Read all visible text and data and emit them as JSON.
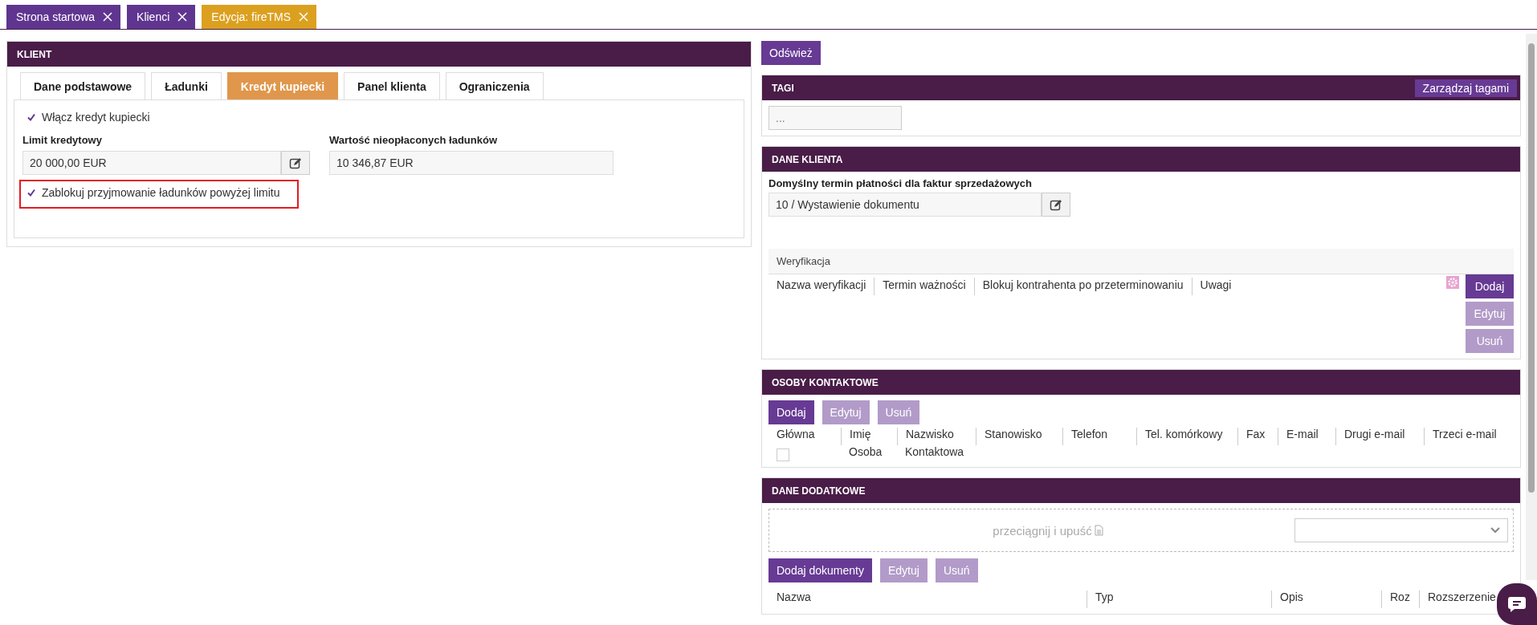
{
  "tabs": [
    {
      "label": "Strona startowa",
      "selected": false
    },
    {
      "label": "Klienci",
      "selected": false
    },
    {
      "label": "Edycja: fireTMS",
      "selected": true
    }
  ],
  "client": {
    "title": "KLIENT",
    "tabs": [
      {
        "label": "Dane podstawowe",
        "selected": false
      },
      {
        "label": "Ładunki",
        "selected": false
      },
      {
        "label": "Kredyt kupiecki",
        "selected": true
      },
      {
        "label": "Panel klienta",
        "selected": false
      },
      {
        "label": "Ograniczenia",
        "selected": false
      }
    ],
    "enable_credit": {
      "label": "Włącz kredyt kupiecki",
      "checked": true
    },
    "credit_limit": {
      "label": "Limit kredytowy",
      "value": "20 000,00 EUR"
    },
    "unpaid_value": {
      "label": "Wartość nieopłaconych ładunków",
      "value": "10 346,87 EUR"
    },
    "block_over_limit": {
      "label": "Zablokuj przyjmowanie ładunków powyżej limitu",
      "checked": true,
      "highlighted": true
    }
  },
  "refresh_button": "Odśwież",
  "tags": {
    "title": "TAGI",
    "manage_button": "Zarządzaj tagami",
    "placeholder": "..."
  },
  "client_data": {
    "title": "DANE KLIENTA",
    "payment_term": {
      "label": "Domyślny termin płatności dla faktur sprzedażowych",
      "value": "10 / Wystawienie dokumentu"
    },
    "verification": {
      "title": "Weryfikacja",
      "columns": [
        "Nazwa weryfikacji",
        "Termin ważności",
        "Blokuj kontrahenta po przeterminowaniu",
        "Uwagi"
      ],
      "buttons": [
        {
          "label": "Dodaj",
          "disabled": false
        },
        {
          "label": "Edytuj",
          "disabled": true
        },
        {
          "label": "Usuń",
          "disabled": true
        }
      ]
    }
  },
  "contacts": {
    "title": "OSOBY KONTAKTOWE",
    "buttons": [
      {
        "label": "Dodaj",
        "disabled": false
      },
      {
        "label": "Edytuj",
        "disabled": true
      },
      {
        "label": "Usuń",
        "disabled": true
      }
    ],
    "columns": [
      "Główna",
      "Imię",
      "Nazwisko",
      "Stanowisko",
      "Telefon",
      "Tel. komórkowy",
      "Fax",
      "E-mail",
      "Drugi e-mail",
      "Trzeci e-mail"
    ],
    "rows": [
      {
        "main": false,
        "first_name": "Osoba",
        "last_name": "Kontaktowa"
      }
    ]
  },
  "additional": {
    "title": "DANE DODATKOWE",
    "drop_zone": "przeciągnij i upuść",
    "buttons": [
      {
        "label": "Dodaj dokumenty",
        "disabled": false
      },
      {
        "label": "Edytuj",
        "disabled": true
      },
      {
        "label": "Usuń",
        "disabled": true
      }
    ],
    "columns": [
      "Nazwa",
      "Typ",
      "Opis",
      "Roz",
      "Rozszerzenie"
    ]
  }
}
